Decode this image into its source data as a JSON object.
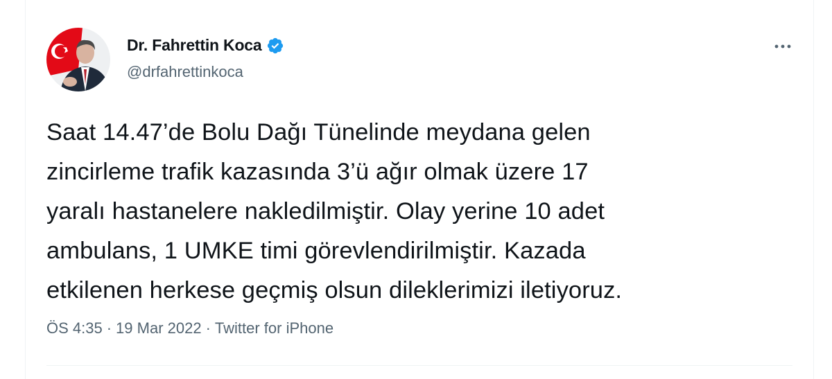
{
  "author": {
    "display_name": "Dr. Fahrettin Koca",
    "handle": "@drfahrettinkoca",
    "verified": true
  },
  "tweet": {
    "lines": [
      "Saat 14.47’de Bolu Dağı Tünelinde meydana gelen",
      "zincirleme trafik kazasında 3’ü ağır olmak üzere 17",
      "yaralı hastanelere nakledilmiştir. Olay yerine 10 adet",
      "ambulans, 1 UMKE timi görevlendirilmiştir. Kazada",
      "etkilenen herkese geçmiş olsun dileklerimizi iletiyoruz."
    ]
  },
  "meta": {
    "time": "ÖS 4:35",
    "separator": "·",
    "date": "19 Mar 2022",
    "source": "Twitter for iPhone"
  },
  "icons": {
    "more": "more-horizontal-icon",
    "verified": "verified-badge-icon"
  },
  "colors": {
    "text": "#0f1419",
    "secondary": "#536471",
    "verified": "#1d9bf0",
    "avatar_flag": "#e30a17"
  }
}
